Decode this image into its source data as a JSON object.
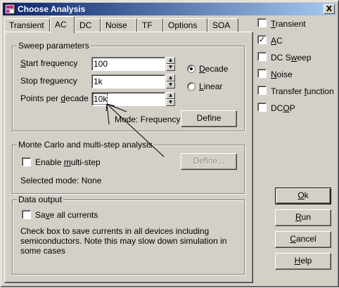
{
  "window": {
    "title": "Choose Analysis",
    "close_label": "X"
  },
  "tabs": [
    {
      "label": "Transient"
    },
    {
      "label": "AC"
    },
    {
      "label": "DC"
    },
    {
      "label": "Noise"
    },
    {
      "label": "TF"
    },
    {
      "label": "Options"
    },
    {
      "label": "SOA"
    }
  ],
  "sweep": {
    "group_label": "Sweep parameters",
    "start_label_u": "S",
    "start_label_rest": "tart frequency",
    "start_value": "100",
    "stop_label_pre": "Stop fre",
    "stop_label_u": "q",
    "stop_label_rest": "uency",
    "stop_value": "1k",
    "points_label_pre": "Points per ",
    "points_label_u": "d",
    "points_label_rest": "ecade",
    "points_value": "10k",
    "decade_label_u": "D",
    "decade_label_rest": "ecade",
    "linear_label_u": "L",
    "linear_label_rest": "inear",
    "mode_text": "Mode: Frequency",
    "define_label": "Define"
  },
  "monte_carlo": {
    "group_label": "Monte Carlo and multi-step analysis",
    "enable_pre": "Enable ",
    "enable_u": "m",
    "enable_rest": "ulti-step",
    "define_label": "Define...",
    "selected_mode": "Selected mode: None"
  },
  "data_output": {
    "group_label": "Data output",
    "save_pre": "Sa",
    "save_u": "v",
    "save_rest": "e all currents",
    "description": "Check box to save currents in all devices including semiconductors. Note this may slow down simulation in some cases"
  },
  "analyses": [
    {
      "u": "T",
      "rest": "ransient",
      "checked": false
    },
    {
      "u": "A",
      "rest": "C",
      "checked": true
    },
    {
      "pre": "DC S",
      "u": "w",
      "rest": "eep",
      "checked": false
    },
    {
      "u": "N",
      "rest": "oise",
      "checked": false
    },
    {
      "pre": "Transfer ",
      "u": "f",
      "rest": "unction",
      "checked": false
    },
    {
      "pre": "DC",
      "u": "O",
      "rest": "P",
      "checked": false
    }
  ],
  "buttons": {
    "ok_u": "O",
    "ok_rest": "k",
    "run_u": "R",
    "run_rest": "un",
    "cancel_u": "C",
    "cancel_rest": "ancel",
    "help_u": "H",
    "help_rest": "elp"
  },
  "glyphs": {
    "check": "✓",
    "up": "▲",
    "down": "▼"
  }
}
